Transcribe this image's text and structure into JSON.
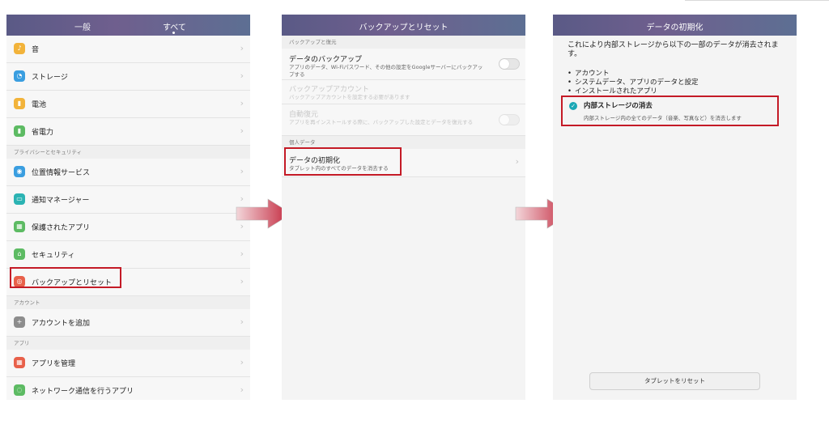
{
  "panel1": {
    "tabs": [
      "一般",
      "すべて"
    ],
    "sections": {
      "privacy": "プライバシーとセキュリティ",
      "account": "アカウント",
      "apps": "アプリ"
    },
    "items": [
      {
        "label": "音",
        "icon": "speaker-icon",
        "color": "#f2b33a"
      },
      {
        "label": "ストレージ",
        "icon": "storage-icon",
        "color": "#3a9ee0"
      },
      {
        "label": "電池",
        "icon": "battery-icon",
        "color": "#f2b33a"
      },
      {
        "label": "省電力",
        "icon": "power-saving-icon",
        "color": "#5dbb63"
      },
      {
        "label": "位置情報サービス",
        "icon": "location-icon",
        "color": "#3a9ee0"
      },
      {
        "label": "通知マネージャー",
        "icon": "notification-icon",
        "color": "#2bb3b3"
      },
      {
        "label": "保護されたアプリ",
        "icon": "protected-apps-icon",
        "color": "#5dbb63"
      },
      {
        "label": "セキュリティ",
        "icon": "lock-icon",
        "color": "#5dbb63"
      },
      {
        "label": "バックアップとリセット",
        "icon": "backup-icon",
        "color": "#e8604a"
      },
      {
        "label": "アカウントを追加",
        "icon": "plus-icon",
        "color": "#8d8d8d"
      },
      {
        "label": "アプリを管理",
        "icon": "apps-grid-icon",
        "color": "#e8604a"
      },
      {
        "label": "ネットワーク通信を行うアプリ",
        "icon": "network-icon",
        "color": "#5dbb63"
      }
    ]
  },
  "panel2": {
    "title": "バックアップとリセット",
    "section_backup": "バックアップと復元",
    "backup_title": "データのバックアップ",
    "backup_desc": "アプリのデータ、Wi-Fiパスワード、その他の設定をGoogleサーバーにバックアップする",
    "account_title": "バックアップアカウント",
    "account_desc": "バックアップアカウントを設定する必要があります",
    "restore_title": "自動復元",
    "restore_desc": "アプリを再インストールする際に、バックアップした設定とデータを復元する",
    "section_personal": "個人データ",
    "reset_title": "データの初期化",
    "reset_desc": "タブレット内のすべてのデータを消去する"
  },
  "panel3": {
    "title": "データの初期化",
    "warning": "これにより内部ストレージから以下の一部のデータが消去されます。",
    "bullets": [
      "アカウント",
      "システムデータ、アプリのデータと設定",
      "インストールされたアプリ"
    ],
    "option_title": "内部ストレージの消去",
    "option_desc": "内部ストレージ内の全てのデータ（音楽、写真など）を消去します",
    "button": "タブレットをリセット"
  },
  "colors": {
    "header_gradient_start": "#5a5a86",
    "highlight": "#c41a26",
    "arrow": "#c2243a",
    "check": "#1aa7b5"
  }
}
